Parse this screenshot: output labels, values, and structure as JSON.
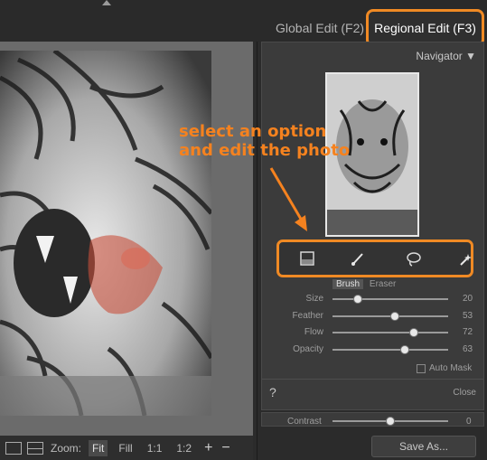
{
  "tabs": {
    "global": "Global Edit (F2)",
    "regional": "Regional Edit (F3)"
  },
  "navigator": {
    "title": "Navigator ▼"
  },
  "tools": [
    "gradient-tool",
    "brush-tool",
    "lasso-tool",
    "magic-wand-tool"
  ],
  "mode": {
    "brush": "Brush",
    "eraser": "Eraser"
  },
  "sliders": [
    {
      "label": "Size",
      "value": "20",
      "pos": 0.2
    },
    {
      "label": "Feather",
      "value": "53",
      "pos": 0.53
    },
    {
      "label": "Flow",
      "value": "72",
      "pos": 0.72
    },
    {
      "label": "Opacity",
      "value": "63",
      "pos": 0.63
    }
  ],
  "automask": "Auto Mask",
  "help": "?",
  "close": "Close",
  "contrast": {
    "label": "Contrast",
    "value": "0",
    "pos": 0.5
  },
  "save_as": "Save As...",
  "bottombar": {
    "zoom_label": "Zoom:",
    "fit": "Fit",
    "fill": "Fill",
    "one_to_one": "1:1",
    "one_to_two": "1:2",
    "plus": "+",
    "minus": "−"
  },
  "annotation": {
    "line1": "select an option",
    "line2": "and edit the photo"
  },
  "colors": {
    "accent": "#f08a24",
    "annotation": "#f5821f",
    "paint_mask": "#c8503c"
  }
}
